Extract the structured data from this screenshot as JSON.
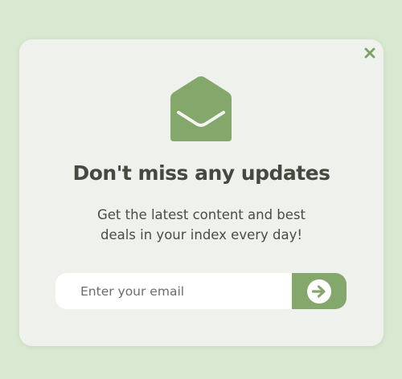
{
  "popup": {
    "title": "Don't miss any updates",
    "subtitle_line1": "Get the latest content and best",
    "subtitle_line2": "deals in your index every day!",
    "email_placeholder": "Enter your email",
    "close_icon": "close-icon",
    "envelope_icon": "open-envelope-icon",
    "submit_icon": "arrow-right-circle-icon"
  },
  "colors": {
    "page_background": "#d9e8d0",
    "card_background": "#eff2ec",
    "accent": "#84a86c",
    "close_icon": "#79a366",
    "title_text": "#45493f",
    "body_text": "#4a4d46",
    "input_background": "#ffffff"
  }
}
